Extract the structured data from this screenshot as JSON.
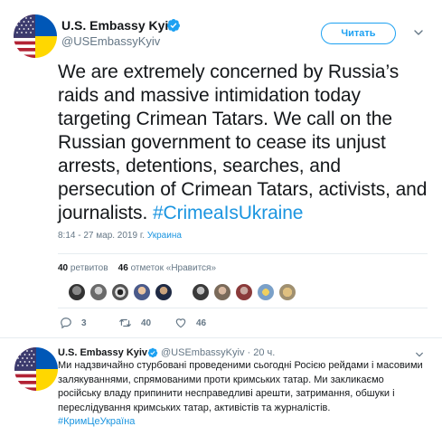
{
  "tweet": {
    "author_name": "U.S. Embassy Kyiv",
    "author_handle": "@USEmbassyKyiv",
    "follow_label": "Читать",
    "text": "We are extremely concerned by Russia’s raids and massive intimidation today targeting Crimean Tatars.  We call on the Russian government to cease its unjust arrests, detentions, searches, and persecution of Crimean Tatars, activists, and journalists.",
    "hashtag": "#CrimeaIsUkraine",
    "timestamp": "8:14 - 27 мар. 2019 г.",
    "location": "Украина",
    "retweets_count": "40",
    "retweets_label": "ретвитов",
    "likes_count": "46",
    "likes_label": "отметок «Нравится»",
    "actions": {
      "reply_count": "3",
      "retweet_count": "40",
      "like_count": "46"
    },
    "liker_avatars": 10
  },
  "reply_tweet": {
    "author_name": "U.S. Embassy Kyiv",
    "author_handle": "@USEmbassyKyiv",
    "time": "· 20 ч.",
    "text": "Ми надзвичайно стурбовані проведеними сьогодні Росією рейдами і масовими залякуваннями, спрямованими проти кримських татар. Ми закликаємо російську владу припинити несправедливі арешти, затримання, обшуки і переслідування кримських татар, активістів та журналістів.",
    "hashtag": "#КримЦеУкраїна"
  },
  "colors": {
    "accent": "#1da1f2",
    "link": "#1b95e0",
    "muted": "#657786",
    "text": "#14171a",
    "flag_blue": "#3c3b6e",
    "flag_red": "#b22234",
    "ukraine_blue": "#0057b7",
    "ukraine_yellow": "#ffd700"
  },
  "icons": [
    "verified-badge-icon",
    "chevron-down-icon",
    "reply-icon",
    "retweet-icon",
    "like-icon"
  ]
}
